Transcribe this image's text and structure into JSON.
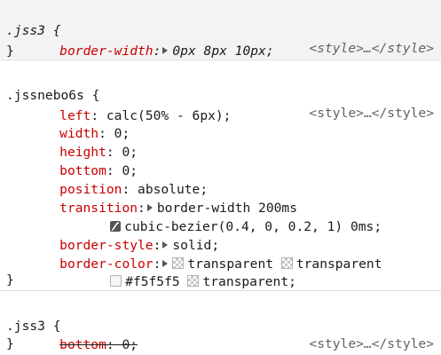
{
  "rule1": {
    "selector": ".jss3 {",
    "source": "<style>…</style>",
    "decls": [
      {
        "prop": "border-width",
        "value": "0px 8px 10px;"
      }
    ],
    "close": "}"
  },
  "rule2": {
    "selector": ".jssnebo6s {",
    "source": "<style>…</style>",
    "left": {
      "prop": "left",
      "value": "calc(50% - 6px);"
    },
    "width": {
      "prop": "width",
      "value": "0;"
    },
    "height": {
      "prop": "height",
      "value": "0;"
    },
    "bottom": {
      "prop": "bottom",
      "value": "0;"
    },
    "position": {
      "prop": "position",
      "value": "absolute;"
    },
    "transition": {
      "prop": "transition",
      "value1": "border-width 200ms",
      "value2": "cubic-bezier(0.4, 0, 0.2, 1) 0ms;"
    },
    "border_style": {
      "prop": "border-style",
      "value": "solid;"
    },
    "border_color": {
      "prop": "border-color",
      "c1": "transparent",
      "c2": "transparent",
      "c3": "#f5f5f5",
      "c3_color": "#f5f5f5",
      "c4": "transparent;"
    },
    "close": "}"
  },
  "rule3": {
    "selector": ".jss3 {",
    "source": "<style>…</style>",
    "bottom": {
      "prop": "bottom",
      "value": "0;"
    },
    "close": "}"
  },
  "colors": {
    "property": "#c80000",
    "source": "#5f6368",
    "separator": "#d9d9d9",
    "shade": "#f3f3f3"
  }
}
